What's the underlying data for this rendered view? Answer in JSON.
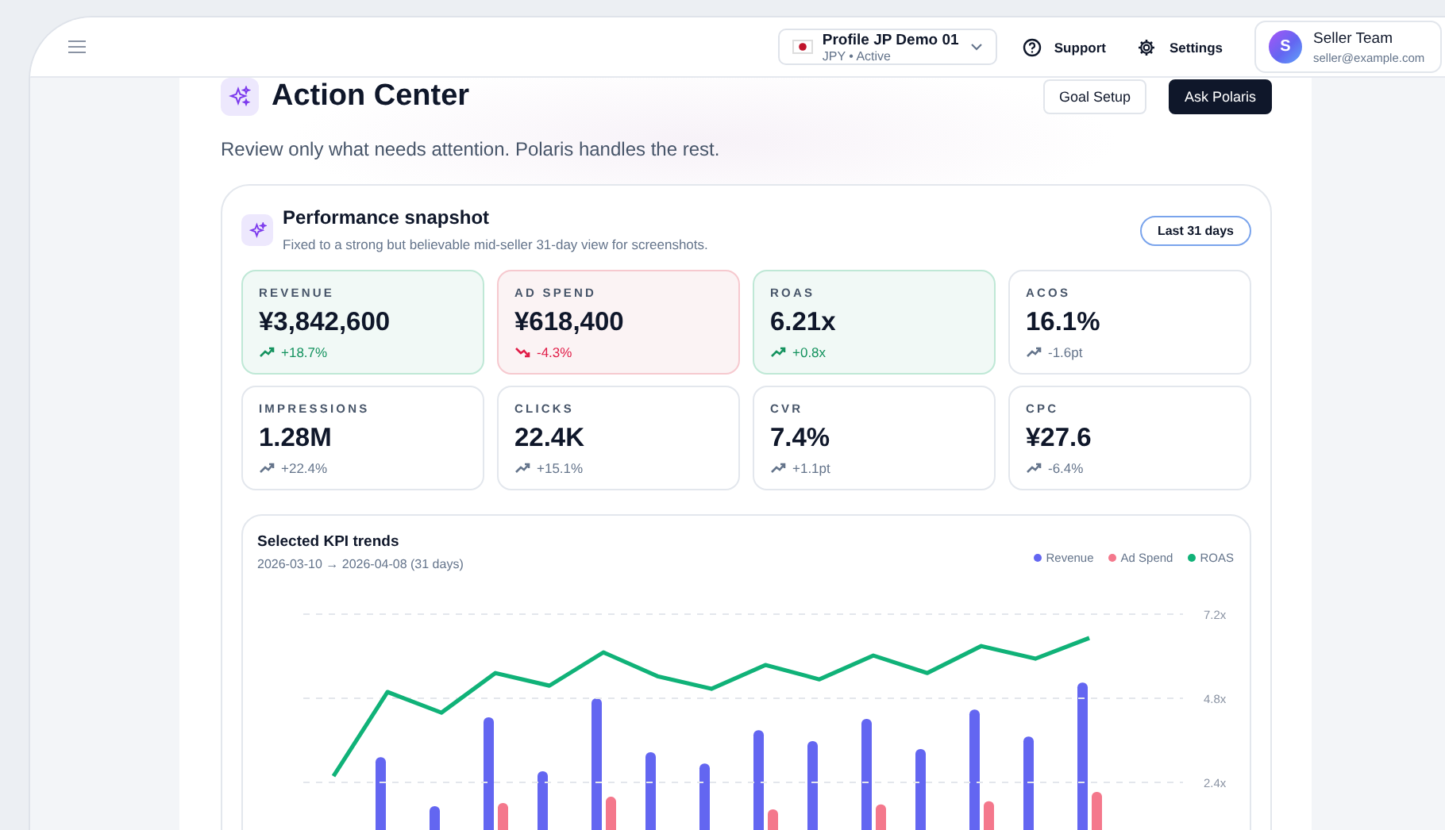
{
  "profile": {
    "name": "Profile JP Demo 01",
    "meta": "JPY • Active"
  },
  "nav": [
    {
      "label": "Support",
      "kind": "help"
    },
    {
      "label": "Settings",
      "kind": "settings"
    }
  ],
  "user": {
    "initial": "S",
    "name": "Seller Team",
    "email": "seller@example.com"
  },
  "page": {
    "title": "Action Center",
    "subtitle": "Review only what needs attention. Polaris handles the rest.",
    "buttons": [
      {
        "label": "Goal Setup",
        "kind": "secondary"
      },
      {
        "label": "Ask Polaris",
        "kind": "primary"
      }
    ]
  },
  "snapshot": {
    "title": "Performance snapshot",
    "subtitle": "Fixed to a strong but believable mid-seller 31-day view for screenshots.",
    "range": "Last 31 days",
    "kpis": [
      {
        "label": "REVENUE",
        "value": "¥3,842,600",
        "delta": {
          "text": "+18.7%",
          "kind": "rise"
        },
        "kind": "positive"
      },
      {
        "label": "AD SPEND",
        "value": "¥618,400",
        "delta": {
          "text": "-4.3%",
          "kind": "fall"
        },
        "kind": "negative"
      },
      {
        "label": "ROAS",
        "value": "6.21x",
        "delta": {
          "text": "+0.8x",
          "kind": "rise"
        },
        "kind": "positive"
      },
      {
        "label": "ACOS",
        "value": "16.1%",
        "delta": {
          "text": "-1.6pt",
          "kind": "rise"
        },
        "kind": "neutral"
      },
      {
        "label": "IMPRESSIONS",
        "value": "1.28M",
        "delta": {
          "text": "+22.4%",
          "kind": "rise"
        },
        "kind": "neutral"
      },
      {
        "label": "CLICKS",
        "value": "22.4K",
        "delta": {
          "text": "+15.1%",
          "kind": "rise"
        },
        "kind": "neutral"
      },
      {
        "label": "CVR",
        "value": "7.4%",
        "delta": {
          "text": "+1.1pt",
          "kind": "rise"
        },
        "kind": "neutral"
      },
      {
        "label": "CPC",
        "value": "¥27.6",
        "delta": {
          "text": "-6.4%",
          "kind": "rise"
        },
        "kind": "neutral"
      }
    ]
  },
  "trends": {
    "title": "Selected KPI trends",
    "range": "2026-03-10 → 2026-04-08 (31 days)",
    "legend": [
      {
        "label": "Revenue",
        "color": "#6366f1"
      },
      {
        "label": "Ad Spend",
        "color": "#f4788c"
      }
    ],
    "chart_data": {
      "type": "line",
      "ylim": [
        2.4,
        7.2
      ],
      "yticks": [
        {
          "value": 2.4,
          "label": "2.4x"
        },
        {
          "value": 4.8,
          "label": "4.8x"
        },
        {
          "value": 7.2,
          "label": "7.2x"
        }
      ],
      "series": [
        {
          "name": "ROAS",
          "color": "#10b278",
          "values": [
            2.58,
            4.98,
            4.39,
            5.52,
            5.16,
            6.11,
            5.43,
            5.07,
            5.75,
            5.34,
            6.02,
            5.52,
            6.29,
            5.93,
            6.52
          ]
        }
      ]
    }
  }
}
